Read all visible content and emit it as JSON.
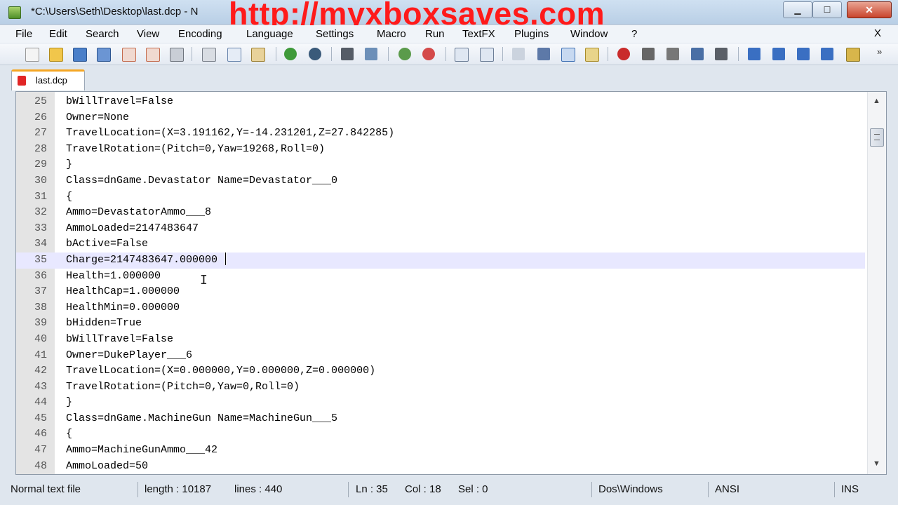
{
  "window": {
    "title": "*C:\\Users\\Seth\\Desktop\\last.dcp - N",
    "watermark": "http://myxboxsaves.com",
    "minimize": "▁",
    "maximize": "☐",
    "close": "✕"
  },
  "menu": {
    "items": [
      "File",
      "Edit",
      "Search",
      "View",
      "Encoding",
      "Language",
      "Settings",
      "Macro",
      "Run",
      "TextFX",
      "Plugins",
      "Window",
      "?"
    ],
    "close_x": "X"
  },
  "toolbar": {
    "icons": [
      "new-file-icon",
      "open-file-icon",
      "save-icon",
      "save-all-icon",
      "close-file-icon",
      "close-all-icon",
      "print-icon",
      "cut-icon",
      "copy-icon",
      "paste-icon",
      "undo-icon",
      "redo-icon",
      "find-icon",
      "replace-icon",
      "zoom-in-icon",
      "zoom-out-icon",
      "sync-vertical-icon",
      "sync-horizontal-icon",
      "word-wrap-icon",
      "show-all-chars-icon",
      "indent-guide-icon",
      "user-language-icon",
      "record-macro-icon",
      "stop-record-icon",
      "play-macro-icon",
      "run-macro-multiple-icon",
      "save-macro-icon",
      "tool-a-icon",
      "tool-b-icon",
      "tool-c-icon",
      "tool-d-icon",
      "tool-e-icon"
    ],
    "more": "»"
  },
  "tabs": [
    {
      "label": "last.dcp"
    }
  ],
  "editor": {
    "current_line": 35,
    "lines": [
      {
        "n": "25",
        "text": "bWillTravel=False"
      },
      {
        "n": "26",
        "text": "Owner=None"
      },
      {
        "n": "27",
        "text": "TravelLocation=(X=3.191162,Y=-14.231201,Z=27.842285)"
      },
      {
        "n": "28",
        "text": "TravelRotation=(Pitch=0,Yaw=19268,Roll=0)"
      },
      {
        "n": "29",
        "text": "}"
      },
      {
        "n": "30",
        "text": "Class=dnGame.Devastator Name=Devastator___0"
      },
      {
        "n": "31",
        "text": "{"
      },
      {
        "n": "32",
        "text": "Ammo=DevastatorAmmo___8"
      },
      {
        "n": "33",
        "text": "AmmoLoaded=2147483647"
      },
      {
        "n": "34",
        "text": "bActive=False"
      },
      {
        "n": "35",
        "text": "Charge=2147483647.000000"
      },
      {
        "n": "36",
        "text": "Health=1.000000"
      },
      {
        "n": "37",
        "text": "HealthCap=1.000000"
      },
      {
        "n": "38",
        "text": "HealthMin=0.000000"
      },
      {
        "n": "39",
        "text": "bHidden=True"
      },
      {
        "n": "40",
        "text": "bWillTravel=False"
      },
      {
        "n": "41",
        "text": "Owner=DukePlayer___6"
      },
      {
        "n": "42",
        "text": "TravelLocation=(X=0.000000,Y=0.000000,Z=0.000000)"
      },
      {
        "n": "43",
        "text": "TravelRotation=(Pitch=0,Yaw=0,Roll=0)"
      },
      {
        "n": "44",
        "text": "}"
      },
      {
        "n": "45",
        "text": "Class=dnGame.MachineGun Name=MachineGun___5"
      },
      {
        "n": "46",
        "text": "{"
      },
      {
        "n": "47",
        "text": "Ammo=MachineGunAmmo___42"
      },
      {
        "n": "48",
        "text": "AmmoLoaded=50"
      }
    ]
  },
  "scrollbar": {
    "up": "▲",
    "down": "▼"
  },
  "status": {
    "file_type": "Normal text file",
    "length": "length : 10187",
    "lines": "lines : 440",
    "ln": "Ln : 35",
    "col": "Col : 18",
    "sel": "Sel : 0",
    "eol": "Dos\\Windows",
    "encoding": "ANSI",
    "mode": "INS"
  }
}
